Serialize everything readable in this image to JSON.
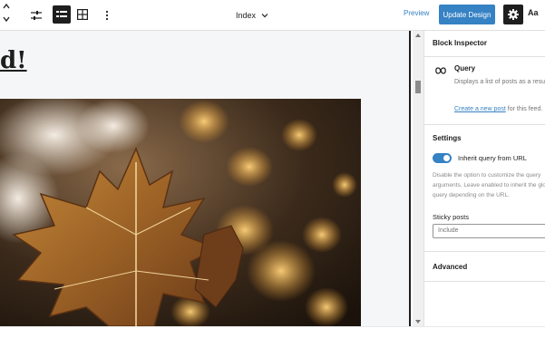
{
  "toolbar": {
    "document_title": "Index",
    "preview_label": "Preview",
    "update_label": "Update Design",
    "styles_label": "Aa"
  },
  "canvas": {
    "post_title": "d!"
  },
  "sidebar": {
    "panel_title": "Block Inspector",
    "block_name": "Query",
    "block_description": "Displays a list of posts as a result of a query.",
    "create_link": "Create a new post",
    "create_suffix": " for this feed.",
    "settings_title": "Settings",
    "inherit_label": "Inherit query from URL",
    "inherit_enabled": true,
    "inherit_help": "Disable the option to customize the query arguments. Leave enabled to inherit the global query depending on the URL.",
    "sticky_label": "Sticky posts",
    "sticky_value": "Include",
    "advanced_title": "Advanced"
  },
  "colors": {
    "accent": "#3582c4",
    "dark": "#1e1e1e",
    "canvas_bg": "#f5f6f7"
  }
}
